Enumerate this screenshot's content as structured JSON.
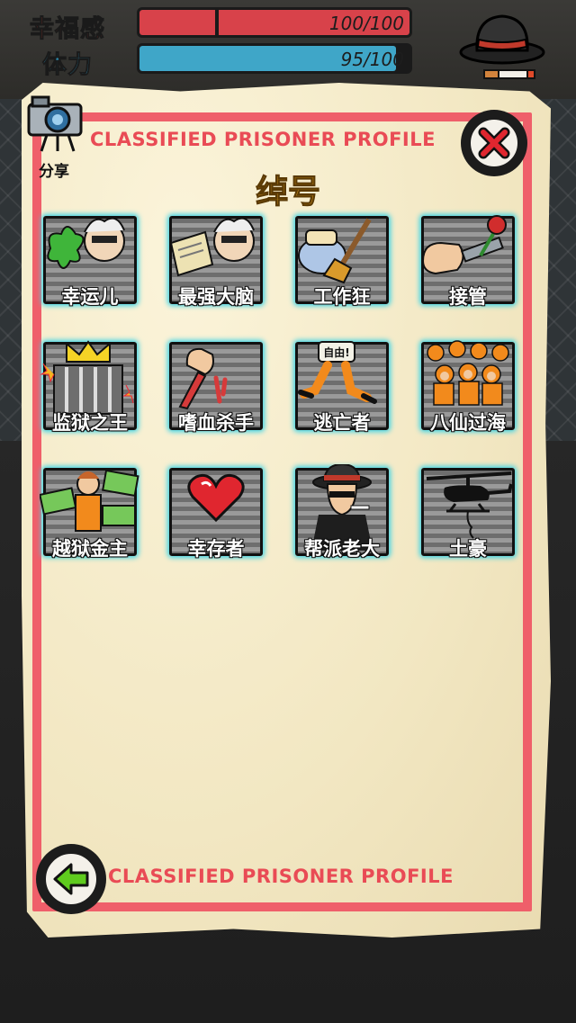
{
  "stats": [
    {
      "label": "幸福感",
      "value_text": "100/100",
      "fill": 1.0,
      "color": "#d8424a",
      "label_color": "#c23a2e"
    },
    {
      "label": "体力",
      "value_text": "95/100",
      "fill": 0.95,
      "color": "#3fa6c8",
      "label_color": "#2e8fb3"
    }
  ],
  "header": {
    "share_label": "分享",
    "title": "CLASSIFIED PRISONER PROFILE",
    "section_title": "绰号"
  },
  "achievements": [
    {
      "label": "幸运儿",
      "icon": "clover-professor-icon"
    },
    {
      "label": "最强大脑",
      "icon": "book-professor-icon"
    },
    {
      "label": "工作狂",
      "icon": "soap-broom-icon"
    },
    {
      "label": "接管",
      "icon": "fist-gun-rose-icon"
    },
    {
      "label": "监狱之王",
      "icon": "crown-cell-icon"
    },
    {
      "label": "嗜血杀手",
      "icon": "bloody-knife-icon"
    },
    {
      "label": "逃亡者",
      "icon": "running-legs-icon"
    },
    {
      "label": "八仙过海",
      "icon": "prisoner-crowd-icon"
    },
    {
      "label": "越狱金主",
      "icon": "money-prisoner-icon"
    },
    {
      "label": "幸存者",
      "icon": "heart-icon"
    },
    {
      "label": "帮派老大",
      "icon": "gangster-hat-icon"
    },
    {
      "label": "土豪",
      "icon": "helicopter-icon"
    }
  ],
  "footer": {
    "title": "CLASSIFIED PRISONER PROFILE"
  },
  "colors": {
    "accent_red": "#e94b55",
    "tile_glow": "#3ad3e6",
    "section_gold": "#b07a16"
  }
}
